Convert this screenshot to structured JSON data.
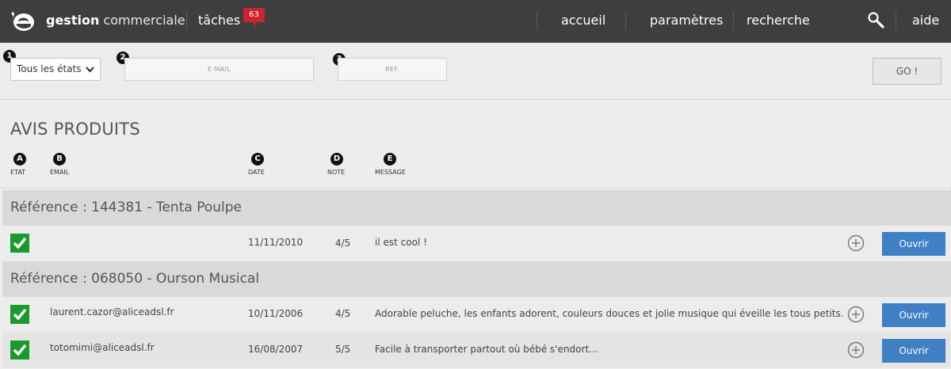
{
  "header": {
    "brand_bold": "gestion",
    "brand_light": "commerciale",
    "tasks_label": "tâches",
    "tasks_count": "63",
    "nav": {
      "home": "accueil",
      "settings": "paramètres",
      "search": "recherche",
      "help": "aide"
    }
  },
  "filters": {
    "markers": [
      "1",
      "2",
      "3"
    ],
    "state_select": "Tous les états",
    "email_placeholder": "E-MAIL",
    "ref_placeholder": "REF.",
    "go_label": "GO !"
  },
  "main": {
    "title": "AVIS PRODUITS",
    "columns": [
      {
        "marker": "A",
        "label": "ETAT"
      },
      {
        "marker": "B",
        "label": "EMAIL"
      },
      {
        "marker": "C",
        "label": "DATE"
      },
      {
        "marker": "D",
        "label": "NOTE"
      },
      {
        "marker": "E",
        "label": "MESSAGE"
      }
    ],
    "groups": [
      {
        "title": "Référence : 144381 - Tenta Poulpe",
        "reviews": [
          {
            "email": "",
            "date": "11/11/2010",
            "note": "4/5",
            "message": "il est cool !",
            "action": "Ouvrir"
          }
        ]
      },
      {
        "title": "Référence : 068050 - Ourson Musical",
        "reviews": [
          {
            "email": "laurent.cazor@aliceadsl.fr",
            "date": "10/11/2006",
            "note": "4/5",
            "message": "Adorable peluche, les enfants adorent, couleurs douces et jolie musique qui éveille les tous petits.",
            "action": "Ouvrir"
          },
          {
            "email": "totomimi@aliceadsl.fr",
            "date": "16/08/2007",
            "note": "5/5",
            "message": "Facile à transporter partout où bébé s'endort...",
            "action": "Ouvrir"
          }
        ]
      }
    ]
  },
  "colors": {
    "topbar": "#3e3e3e",
    "badge": "#c8252c",
    "check": "#1a9a2a",
    "open_button": "#3f7fc4"
  }
}
